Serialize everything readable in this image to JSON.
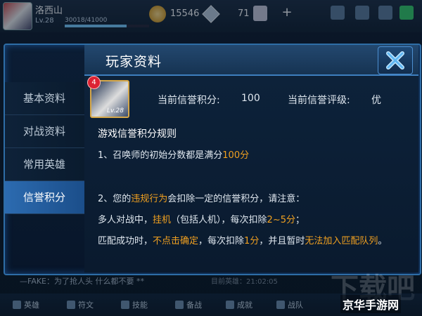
{
  "hud": {
    "player_name": "洛西山",
    "level": "Lv.28",
    "exp": "30018/41000",
    "exp_fraction": 0.73,
    "gold": "15546",
    "tickets": "71"
  },
  "dialog": {
    "title": "玩家资料",
    "tabs": [
      {
        "label": "基本资料",
        "active": false
      },
      {
        "label": "对战资料",
        "active": false
      },
      {
        "label": "常用英雄",
        "active": false
      },
      {
        "label": "信誉积分",
        "active": true
      }
    ],
    "avatar_badge": "4",
    "avatar_level": "Lv.28",
    "credit_score_label": "当前信誉积分:",
    "credit_score_value": "100",
    "credit_rating_label": "当前信誉评级:",
    "credit_rating_value": "优",
    "rules_title": "游戏信誉积分规则",
    "rule1": {
      "a": "1、召唤师的初始分数都是满分",
      "b": "100分"
    },
    "rule2": {
      "a": "2、您的",
      "b": "违规行为",
      "c": "会扣除一定的信誉积分，请注意："
    },
    "rule3": {
      "a": "多人对战中，",
      "b": "挂机",
      "c": "（包括人机），每次扣除",
      "d": "2~5分",
      "e": "；"
    },
    "rule4": {
      "a": "匹配成功时，",
      "b": "不点击确定",
      "c": "，每次扣除",
      "d": "1分",
      "e": "，并且暂时",
      "f": "无法加入匹配队列",
      "g": "。"
    }
  },
  "chat": {
    "message": "—FAKE：为了抢人头 什么都不要 **",
    "right": "目前英雄：21:02:05"
  },
  "bottom_nav": [
    "英雄",
    "符文",
    "技能",
    "备战",
    "成就",
    "战队"
  ],
  "watermark": "京华手游网",
  "watermark_bg": "下载吧",
  "colors": {
    "accent": "#2c6bb0",
    "highlight": "#f0a020"
  }
}
